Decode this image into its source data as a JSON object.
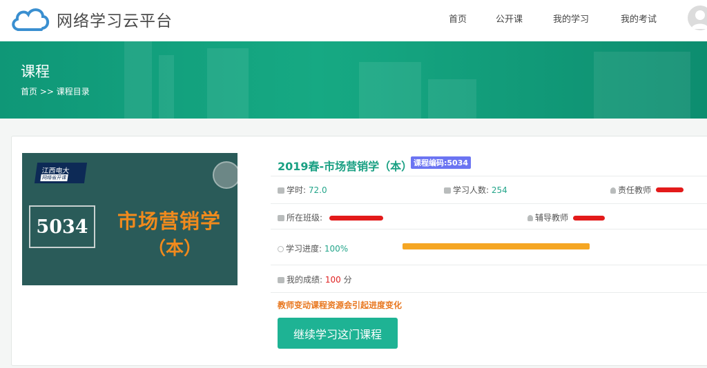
{
  "header": {
    "brand": "网络学习云平台",
    "nav": [
      {
        "label": "首页"
      },
      {
        "label": "公开课"
      },
      {
        "label": "我的学习"
      },
      {
        "label": "我的考试"
      }
    ]
  },
  "banner": {
    "title": "课程",
    "breadcrumb": {
      "home": "首页",
      "sep": ">>",
      "current": "课程目录"
    }
  },
  "course": {
    "cover": {
      "badge_line1": "江西电大",
      "badge_line2": "网络省开课",
      "code": "5034",
      "title": "市场营销学",
      "subtitle": "（本）"
    },
    "title": "2019春-市场营销学（本）",
    "code_badge": "课程编码:5034",
    "hours_label": "学时: ",
    "hours_value": "72.0",
    "learners_label": "学习人数: ",
    "learners_value": "254",
    "teacher_label": "责任教师",
    "class_label": "所在班级: ",
    "tutor_label": "辅导教师",
    "progress_label": "学习进度: ",
    "progress_value": "100%",
    "progress_fraction": 1.0,
    "score_label": "我的成绩: ",
    "score_value": "100",
    "score_unit": " 分",
    "notice": "教师变动课程资源会引起进度变化",
    "continue_button": "继续学习这门课程"
  },
  "colors": {
    "accent": "#1eb394",
    "banner": "#13a07f",
    "progress": "#f5a623",
    "badge": "#6b74f2",
    "warning": "#e8771f"
  }
}
